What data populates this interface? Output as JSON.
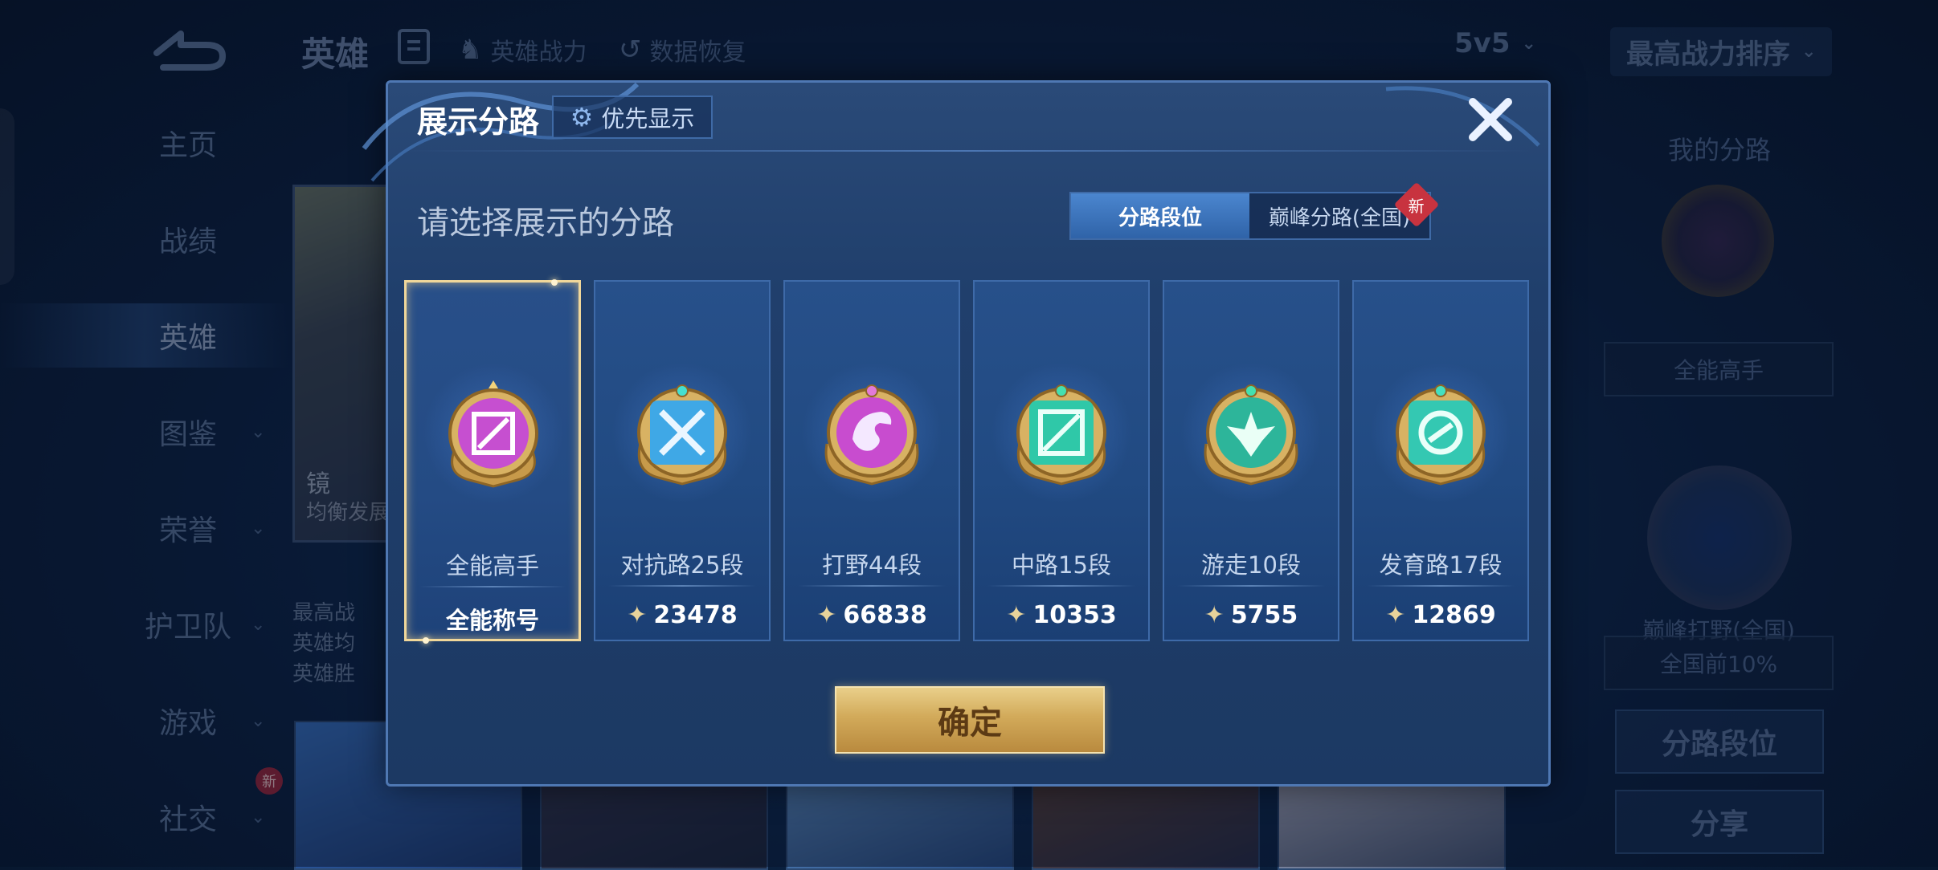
{
  "background": {
    "header": {
      "title": "英雄",
      "link_power": "英雄战力",
      "link_restore": "数据恢复",
      "mode_dropdown": "5v5",
      "sort_dropdown": "最高战力排序"
    },
    "sidebar": {
      "items": [
        {
          "label": "主页"
        },
        {
          "label": "战绩"
        },
        {
          "label": "英雄"
        },
        {
          "label": "图鉴"
        },
        {
          "label": "荣誉"
        },
        {
          "label": "护卫队"
        },
        {
          "label": "游戏"
        },
        {
          "label": "社交"
        }
      ],
      "new_badge": "新"
    },
    "hero": {
      "name": "镜",
      "subtitle": "均衡发展",
      "stats": [
        "最高战",
        "英雄均",
        "英雄胜"
      ]
    },
    "right_panel": {
      "title": "我的分路",
      "lane_title": "全能高手",
      "peak_lane": "巅峰打野(全国)",
      "peak_rank": "全国前10%",
      "btn_lane_rank": "分路段位",
      "btn_share": "分享"
    }
  },
  "modal": {
    "title": "展示分路",
    "priority_label": "优先显示",
    "prompt": "请选择展示的分路",
    "tabs": [
      {
        "label": "分路段位",
        "selected": true
      },
      {
        "label": "巅峰分路(全国)",
        "selected": false,
        "badge": "新"
      }
    ],
    "cards": [
      {
        "name": "全能高手",
        "value": "全能称号",
        "selected": true,
        "color": "#c64fd0"
      },
      {
        "name": "对抗路25段",
        "value": "23478",
        "selected": false,
        "color": "#3fa8e6"
      },
      {
        "name": "打野44段",
        "value": "66838",
        "selected": false,
        "color": "#c84ccf"
      },
      {
        "name": "中路15段",
        "value": "10353",
        "selected": false,
        "color": "#2fc8a8"
      },
      {
        "name": "游走10段",
        "value": "5755",
        "selected": false,
        "color": "#2db59a"
      },
      {
        "name": "发育路17段",
        "value": "12869",
        "selected": false,
        "color": "#34c8b2"
      }
    ],
    "confirm_label": "确定"
  },
  "colors": {
    "modal_bg": "#203f6c",
    "accent_gold": "#d2aa5a",
    "tab_selected": "#3a73bb"
  }
}
